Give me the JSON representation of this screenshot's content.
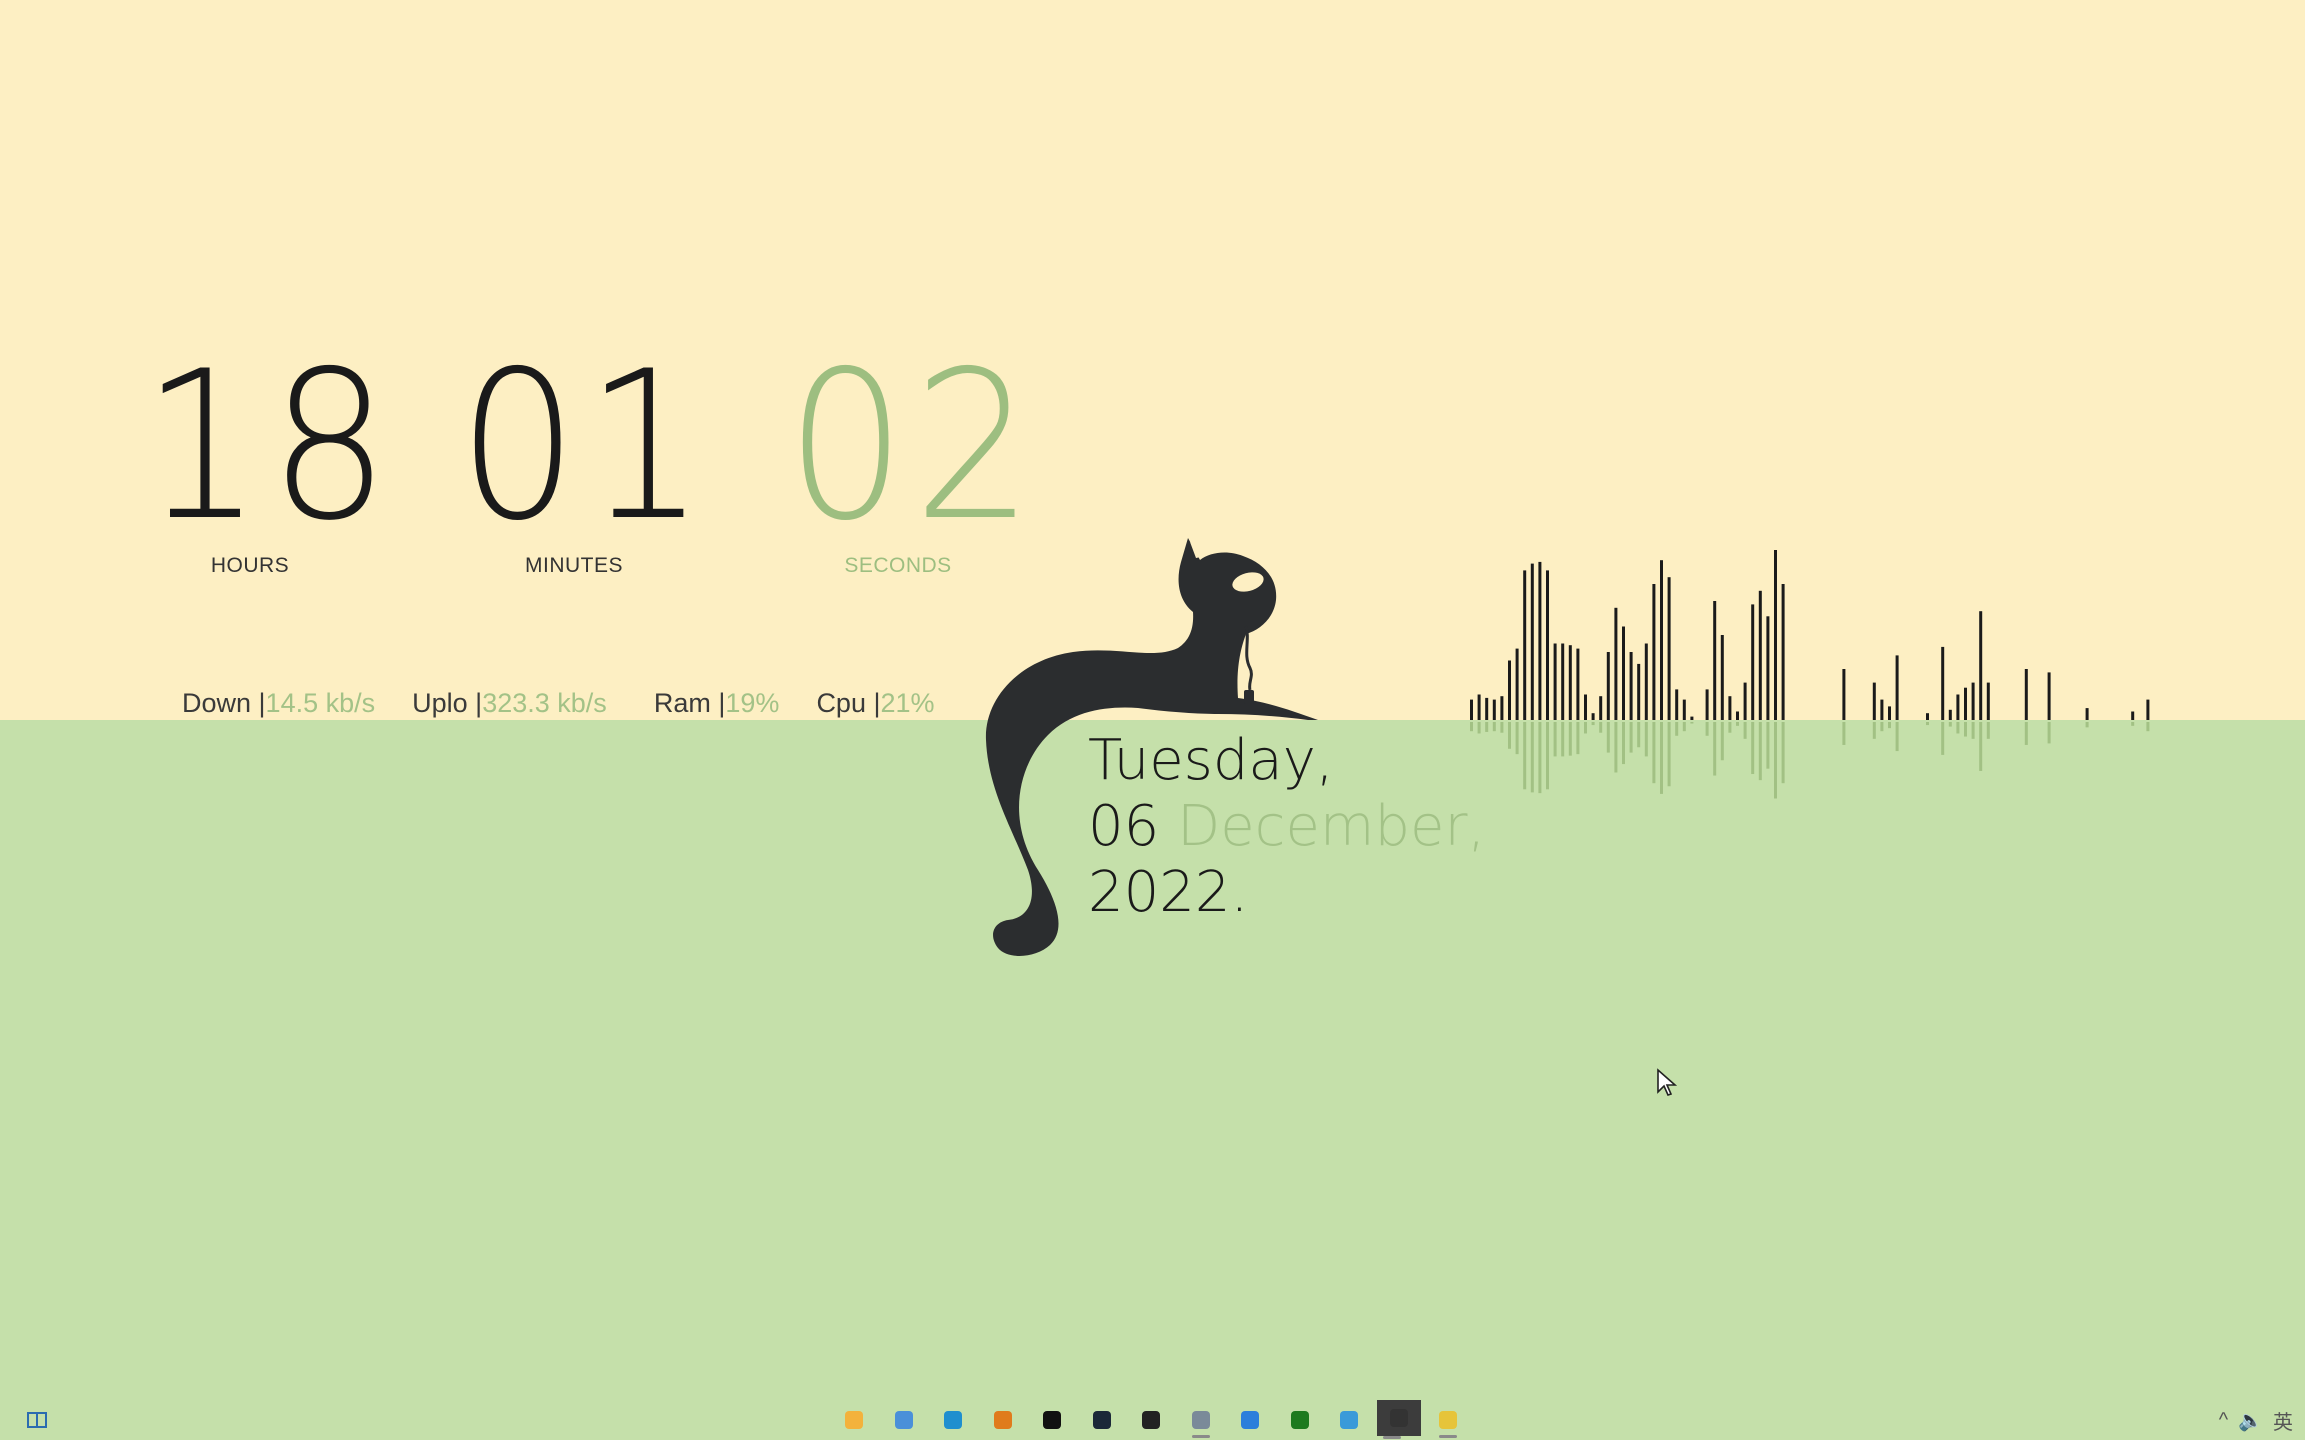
{
  "clock": {
    "hours": "18",
    "minutes": "01",
    "seconds": "02",
    "hours_label": "HOURS",
    "minutes_label": "MINUTES",
    "seconds_label": "SECONDS"
  },
  "stats": {
    "down_label": "Down | ",
    "down_value": "14.5 kb/s",
    "up_label": "Uplo | ",
    "up_value": "323.3 kb/s",
    "ram_label": "Ram | ",
    "ram_value": "19%",
    "cpu_label": "Cpu | ",
    "cpu_value": "21%"
  },
  "date": {
    "weekday": "Tuesday,",
    "day": "06",
    "month": "December,",
    "year": "2022."
  },
  "visualizer": {
    "bar_levels": [
      0.12,
      0.15,
      0.13,
      0.12,
      0.14,
      0.35,
      0.42,
      0.88,
      0.92,
      0.93,
      0.88,
      0.45,
      0.45,
      0.44,
      0.42,
      0.15,
      0.04,
      0.14,
      0.4,
      0.66,
      0.55,
      0.4,
      0.33,
      0.45,
      0.8,
      0.94,
      0.84,
      0.18,
      0.12,
      0.02,
      0.0,
      0.18,
      0.7,
      0.5,
      0.14,
      0.05,
      0.22,
      0.68,
      0.76,
      0.61,
      1.0,
      0.8,
      0.0,
      0.0,
      0.0,
      0.0,
      0.0,
      0.0,
      0.0,
      0.3,
      0.0,
      0.0,
      0.0,
      0.22,
      0.12,
      0.08,
      0.38,
      0.0,
      0.0,
      0.0,
      0.04,
      0.0,
      0.43,
      0.06,
      0.15,
      0.19,
      0.22,
      0.64,
      0.22,
      0.0,
      0.0,
      0.0,
      0.0,
      0.3,
      0.0,
      0.0,
      0.28,
      0.0,
      0.0,
      0.0,
      0.0,
      0.07,
      0.0,
      0.0,
      0.0,
      0.0,
      0.0,
      0.05,
      0.0,
      0.12
    ],
    "bar_color": "#1a1a1a",
    "reflection_color": "#9dbe80"
  },
  "colors": {
    "top_background": "#fdefc3",
    "bottom_background": "#c5e0aa",
    "accent_green": "#a3c287",
    "text_dark": "#1a1a1a"
  },
  "taskbar": {
    "left_icons": [
      "widgets-icon"
    ],
    "apps": [
      {
        "name": "file-explorer-icon",
        "color": "#f3b23c"
      },
      {
        "name": "app-grid-icon",
        "color": "#4a90d9"
      },
      {
        "name": "edge-browser-icon",
        "color": "#1f8fcf"
      },
      {
        "name": "orange-app-icon",
        "color": "#e07b1c"
      },
      {
        "name": "capcut-icon",
        "color": "#111111"
      },
      {
        "name": "steam-icon",
        "color": "#1b2838"
      },
      {
        "name": "bilibili-icon",
        "color": "#222222"
      },
      {
        "name": "teapot-app-icon",
        "color": "#7a8a99"
      },
      {
        "name": "bird-app-icon",
        "color": "#2b7fdb"
      },
      {
        "name": "terminal-play-icon",
        "color": "#1e7a1e"
      },
      {
        "name": "globe-app-icon",
        "color": "#3a9ad9"
      },
      {
        "name": "active-window-icon",
        "color": "#333333"
      },
      {
        "name": "yellow-app-icon",
        "color": "#e6c43a"
      }
    ],
    "tray": {
      "chevron": "^",
      "volume": "🔈",
      "ime": "英"
    }
  }
}
